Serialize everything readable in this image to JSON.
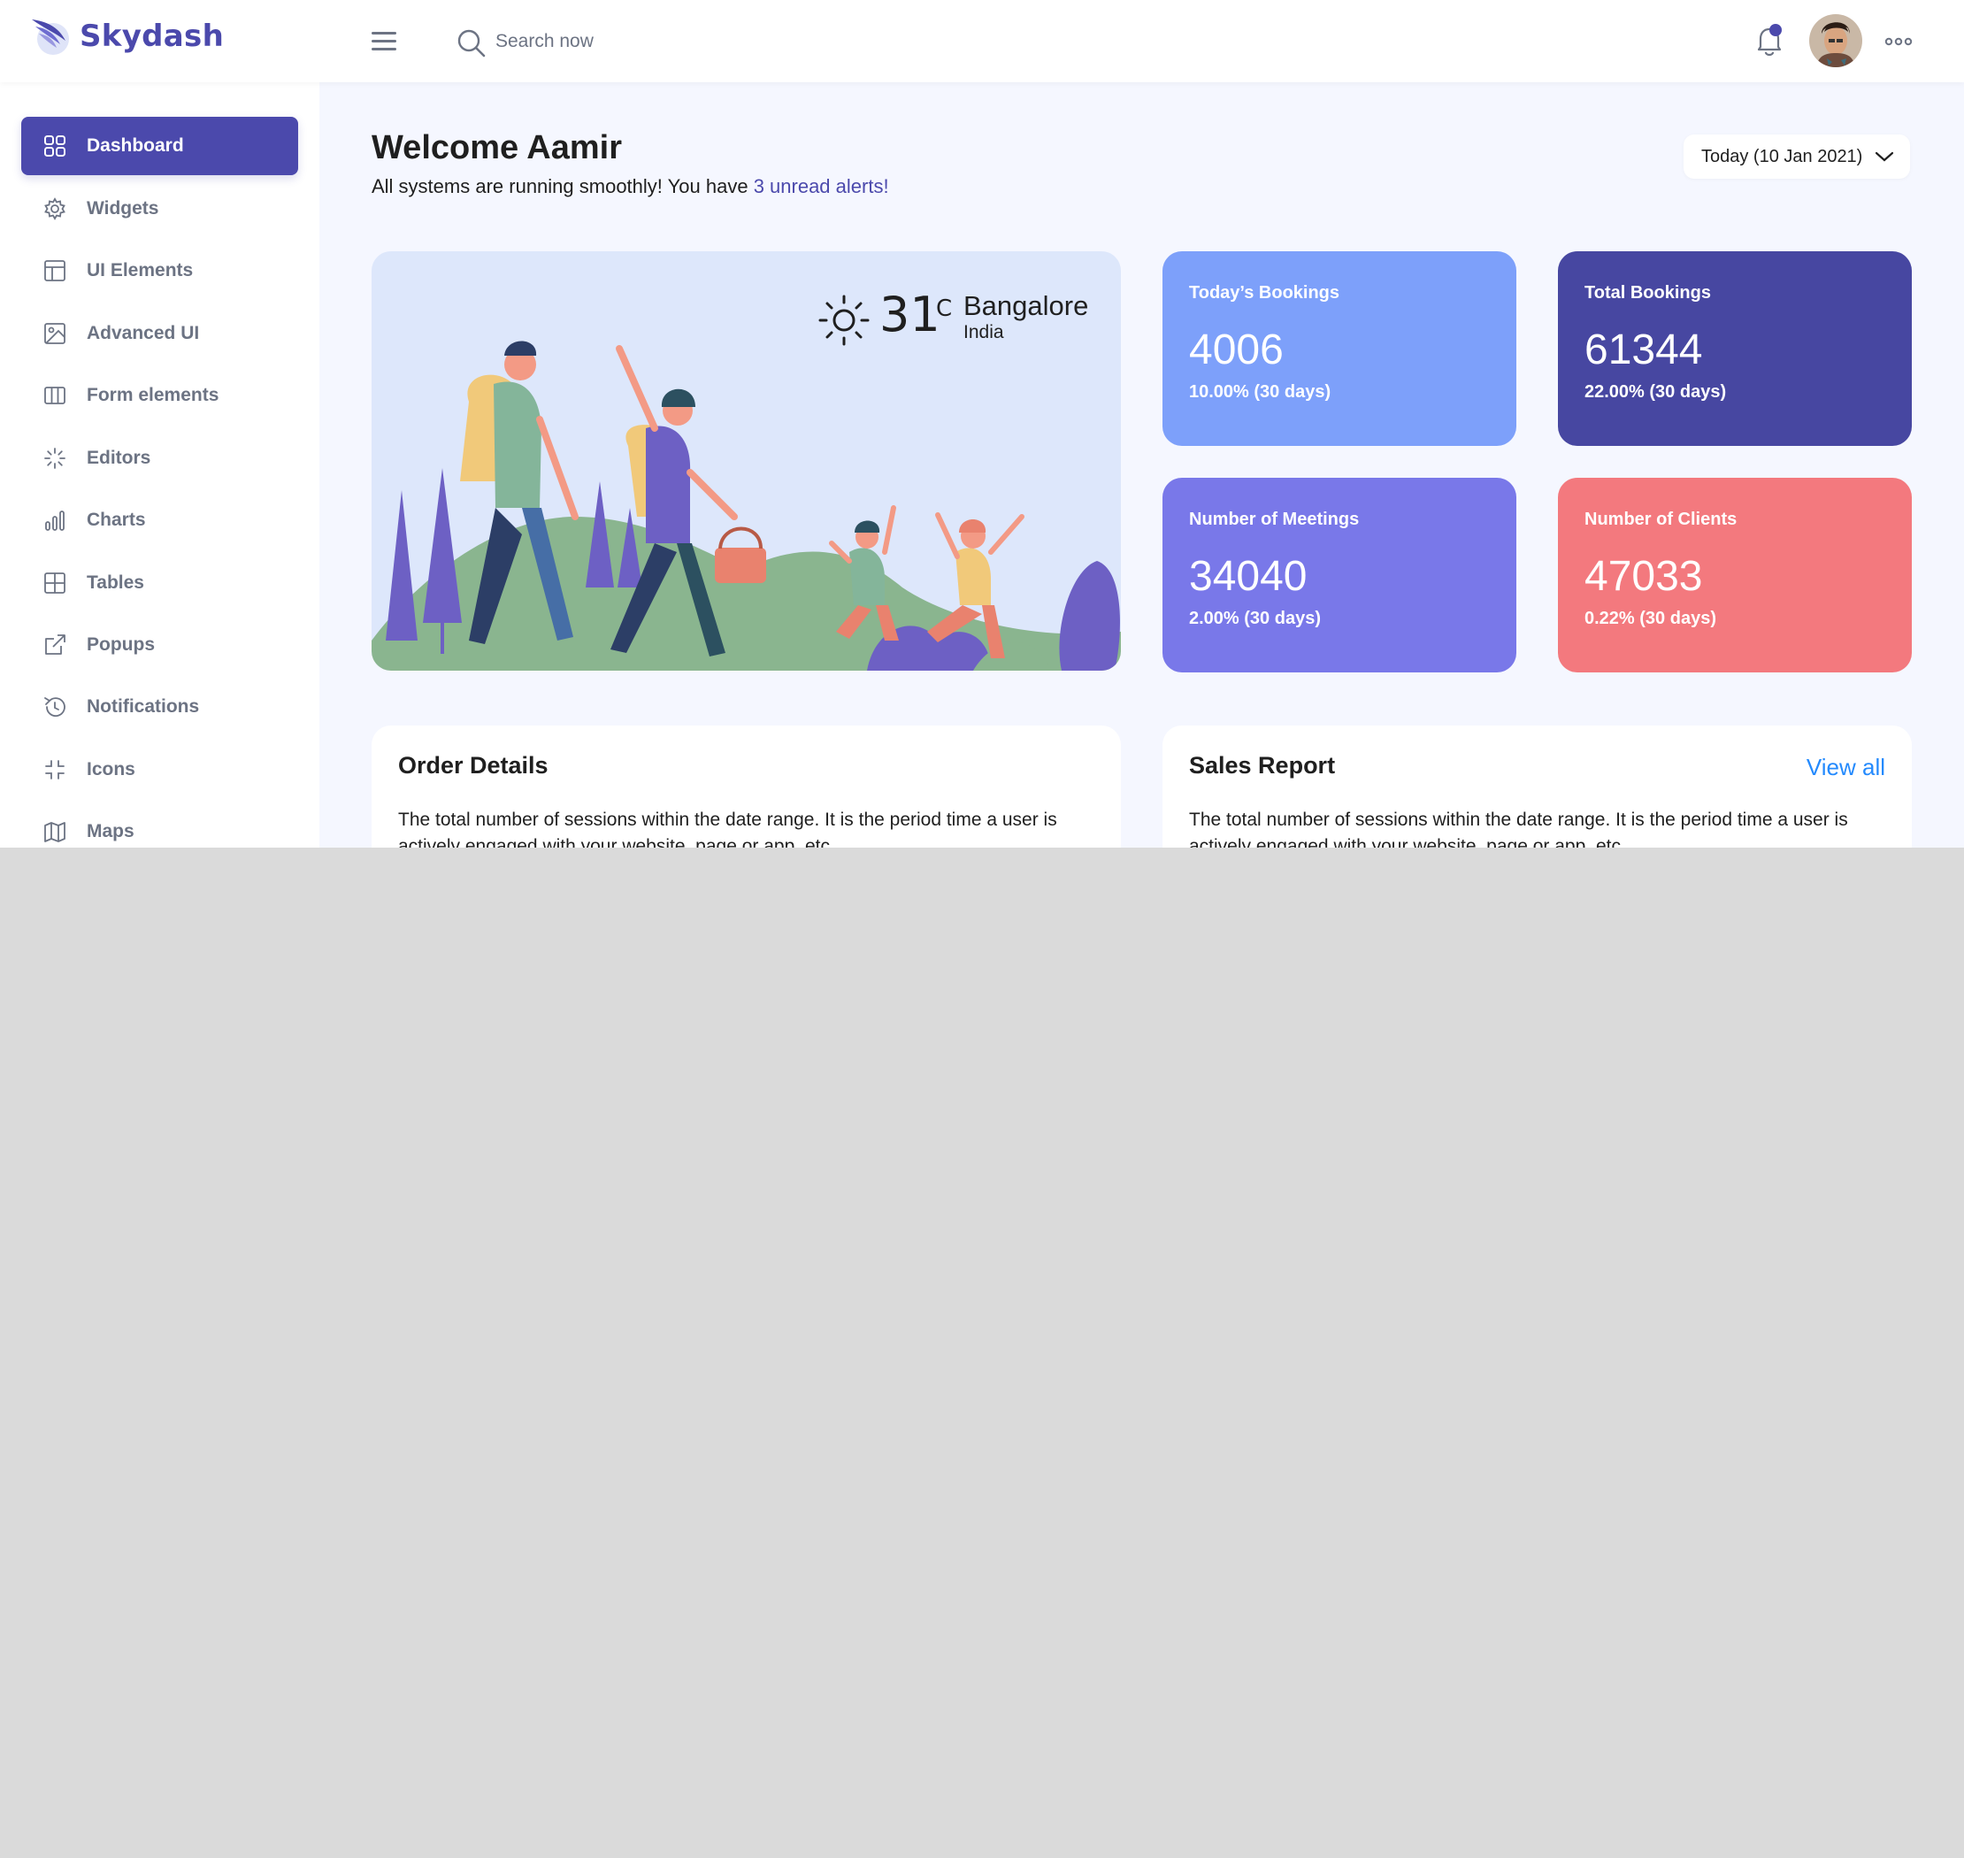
{
  "app": {
    "name": "Skydash"
  },
  "header": {
    "search_placeholder": "Search now",
    "icons": [
      "menu-icon",
      "search-icon",
      "bell-icon",
      "more-icon"
    ]
  },
  "sidebar": {
    "items": [
      {
        "label": "Dashboard",
        "icon": "grid-icon",
        "active": true
      },
      {
        "label": "Widgets",
        "icon": "gear-icon"
      },
      {
        "label": "UI Elements",
        "icon": "layout-icon"
      },
      {
        "label": "Advanced UI",
        "icon": "image-icon"
      },
      {
        "label": "Form elements",
        "icon": "columns-icon"
      },
      {
        "label": "Editors",
        "icon": "loader-icon"
      },
      {
        "label": "Charts",
        "icon": "bar-chart-icon"
      },
      {
        "label": "Tables",
        "icon": "table-icon"
      },
      {
        "label": "Popups",
        "icon": "external-link-icon"
      },
      {
        "label": "Notifications",
        "icon": "history-icon"
      },
      {
        "label": "Icons",
        "icon": "minimize-icon"
      },
      {
        "label": "Maps",
        "icon": "map-icon"
      }
    ]
  },
  "main": {
    "welcome": "Welcome Aamir",
    "subline_prefix": "All systems are running smoothly! You have ",
    "subline_link": "3 unread alerts!",
    "date_filter": "Today (10 Jan 2021)",
    "weather": {
      "temp": "31",
      "unit": "C",
      "city": "Bangalore",
      "country": "India"
    },
    "stats": [
      {
        "title": "Today’s Bookings",
        "value": "4006",
        "sub": "10.00% (30 days)",
        "color": "#7da0fa"
      },
      {
        "title": "Total Bookings",
        "value": "61344",
        "sub": "22.00% (30 days)",
        "color": "#4747a1"
      },
      {
        "title": "Number of Meetings",
        "value": "34040",
        "sub": "2.00% (30 days)",
        "color": "#7978e9"
      },
      {
        "title": "Number of Clients",
        "value": "47033",
        "sub": "0.22% (30 days)",
        "color": "#f3797e"
      }
    ],
    "cards": [
      {
        "title": "Order Details",
        "text": "The total number of sessions within the date range. It is the period time a user is actively engaged with your website, page or app, etc"
      },
      {
        "title": "Sales Report",
        "link": "View all",
        "text": "The total number of sessions within the date range. It is the period time a user is actively engaged with your website, page or app, etc"
      }
    ]
  },
  "colors": {
    "brand": "#4b49ac",
    "link": "#248afd",
    "background": "#f5f7ff"
  }
}
